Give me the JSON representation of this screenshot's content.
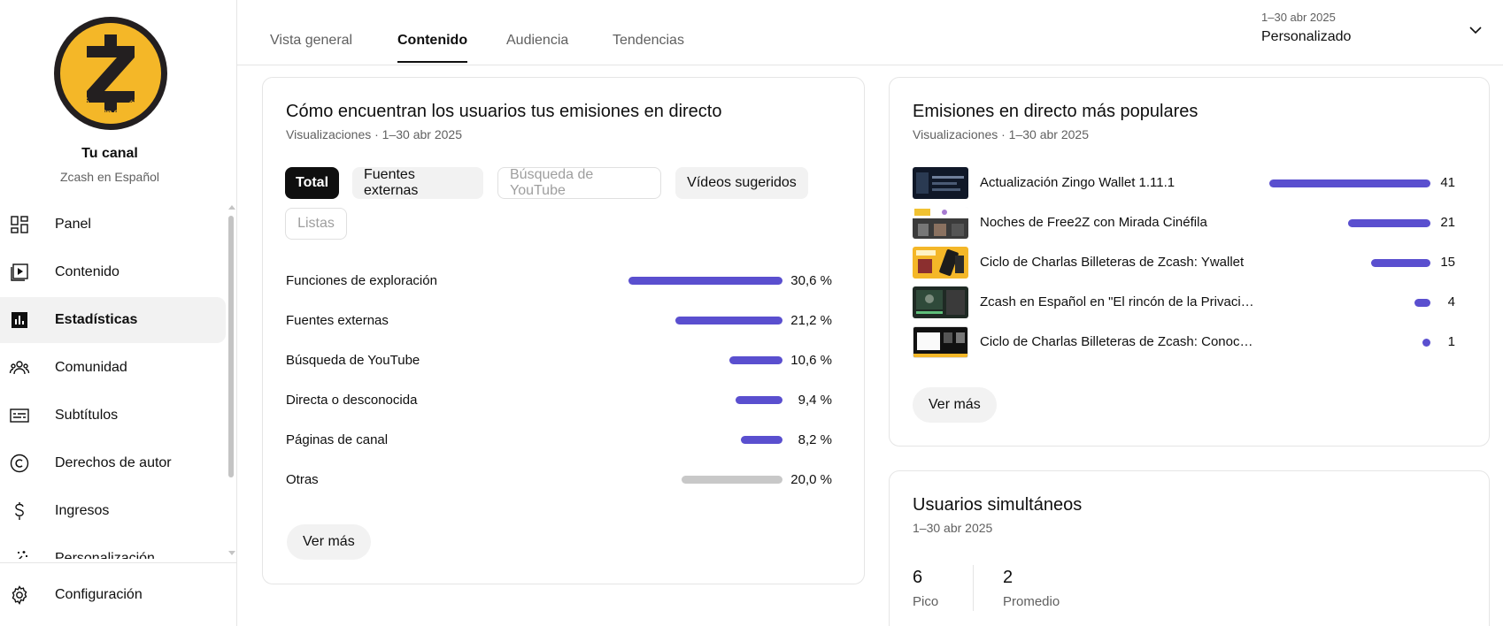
{
  "sidebar": {
    "logo_text": "Zcash en español",
    "channel_title": "Tu canal",
    "channel_name": "Zcash en Español",
    "items": [
      {
        "label": "Panel",
        "icon": "dashboard-icon"
      },
      {
        "label": "Contenido",
        "icon": "content-icon"
      },
      {
        "label": "Estadísticas",
        "icon": "analytics-icon",
        "active": true
      },
      {
        "label": "Comunidad",
        "icon": "community-icon"
      },
      {
        "label": "Subtítulos",
        "icon": "subtitles-icon"
      },
      {
        "label": "Derechos de autor",
        "icon": "copyright-icon"
      },
      {
        "label": "Ingresos",
        "icon": "earn-icon"
      },
      {
        "label": "Personalización",
        "icon": "customization-icon"
      }
    ],
    "settings_label": "Configuración"
  },
  "header": {
    "tabs": [
      "Vista general",
      "Contenido",
      "Audiencia",
      "Tendencias"
    ],
    "active_tab": "Contenido",
    "date_range": "1–30 abr 2025",
    "date_mode": "Personalizado"
  },
  "sources_card": {
    "title": "Cómo encuentran los usuarios tus emisiones en directo",
    "subtitle": "Visualizaciones · 1–30 abr 2025",
    "chips": [
      "Total",
      "Fuentes externas",
      "Búsqueda de YouTube",
      "Vídeos sugeridos",
      "Listas"
    ],
    "rows": [
      {
        "label": "Funciones de exploración",
        "value": "30,6 %",
        "pct": 30.6
      },
      {
        "label": "Fuentes externas",
        "value": "21,2 %",
        "pct": 21.2
      },
      {
        "label": "Búsqueda de YouTube",
        "value": "10,6 %",
        "pct": 10.6
      },
      {
        "label": "Directa o desconocida",
        "value": "9,4 %",
        "pct": 9.4
      },
      {
        "label": "Páginas de canal",
        "value": "8,2 %",
        "pct": 8.2
      },
      {
        "label": "Otras",
        "value": "20,0 %",
        "pct": 20.0
      }
    ],
    "more_label": "Ver más"
  },
  "popular_card": {
    "title": "Emisiones en directo más populares",
    "subtitle": "Visualizaciones · 1–30 abr 2025",
    "items": [
      {
        "title": "Actualización Zingo Wallet 1.11.1",
        "value": "41",
        "count": 41
      },
      {
        "title": "Noches de Free2Z con Mirada Cinéfila",
        "value": "21",
        "count": 21
      },
      {
        "title": "Ciclo de Charlas Billeteras de Zcash: Ywallet",
        "value": "15",
        "count": 15
      },
      {
        "title": "Zcash en Español en \"El rincón de la Privaci…",
        "value": "4",
        "count": 4
      },
      {
        "title": "Ciclo de Charlas Billeteras de Zcash: Conoc…",
        "value": "1",
        "count": 1
      }
    ],
    "more_label": "Ver más"
  },
  "concurrent_card": {
    "title": "Usuarios simultáneos",
    "subtitle": "1–30 abr 2025",
    "peak_value": "6",
    "peak_label": "Pico",
    "avg_value": "2",
    "avg_label": "Promedio"
  },
  "colors": {
    "bar": "#5a4fcf",
    "bar_other": "#c8c8c8",
    "logo_yellow": "#f4b728"
  }
}
